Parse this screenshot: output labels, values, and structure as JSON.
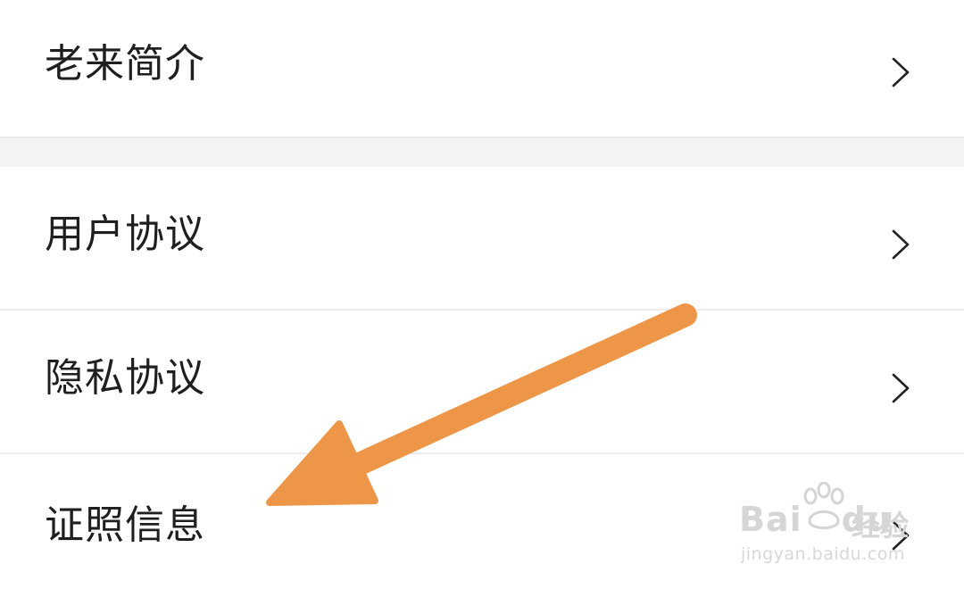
{
  "menu": {
    "items": [
      {
        "label": "老来简介"
      },
      {
        "label": "用户协议"
      },
      {
        "label": "隐私协议"
      },
      {
        "label": "证照信息"
      }
    ]
  },
  "annotation": {
    "arrow_color": "#ee9648"
  },
  "watermark": {
    "brand": "Bai",
    "brand_2": "du",
    "product": "经验",
    "url": "jingyan.baidu.com"
  },
  "icons": {
    "row_chevron": "chevron-right-icon"
  }
}
